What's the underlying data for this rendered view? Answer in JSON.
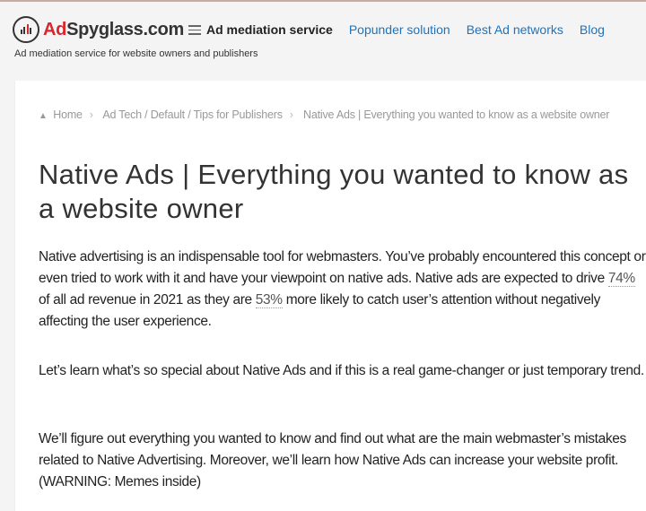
{
  "header": {
    "logo_accent": "Ad",
    "logo_rest": "Spyglass.com",
    "tagline": "Ad mediation service for website owners and publishers",
    "nav": {
      "main": "Ad mediation service",
      "links": [
        "Popunder solution",
        "Best Ad networks",
        "Blog"
      ]
    }
  },
  "breadcrumb": {
    "home": "Home",
    "category": "Ad Tech / Default / Tips for Publishers",
    "current": "Native Ads | Everything you wanted to know as a website owner"
  },
  "article": {
    "title": "Native Ads | Everything you wanted to know as a website owner",
    "p1": {
      "a": "Native advertising is an indispensable tool for webmasters. You’ve probably encountered this concept or even tried to work with it and have your viewpoint on native ads. Native ads are expected to drive ",
      "s1": "74%",
      "b": " of all ad revenue in 2021 as they are ",
      "s2": "53%",
      "c": " more likely to catch user’s attention without negatively affecting the user experience."
    },
    "p2": "Let’s learn what’s so special about Native Ads and if this is a real game-changer or just temporary trend.",
    "p3": "We’ll figure out everything you wanted to know and find out what are the main webmaster’s mistakes related to Native Advertising. Moreover, we’ll learn how Native Ads can increase your website profit. (WARNING: Memes inside)"
  },
  "colors": {
    "brand": "#d9262c",
    "link": "#1e73be"
  }
}
